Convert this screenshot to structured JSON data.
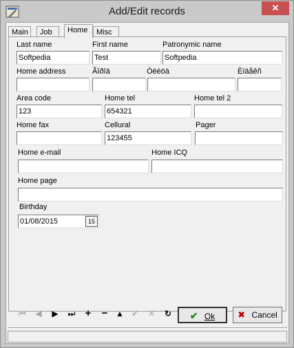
{
  "window": {
    "title": "Add/Edit records",
    "close_glyph": "✕"
  },
  "tabs": [
    {
      "label": "Main"
    },
    {
      "label": "Job"
    },
    {
      "label": "Home"
    },
    {
      "label": "Misc"
    }
  ],
  "home": {
    "last_name": {
      "label": "Last name",
      "value": "Softpedia"
    },
    "first_name": {
      "label": "First name",
      "value": "Test"
    },
    "patronymic_name": {
      "label": "Patronymic name",
      "value": "Softpedia"
    },
    "home_address": {
      "label": "Home address",
      "value": ""
    },
    "garbled_field_1": {
      "label": "Ãîðîä",
      "value": ""
    },
    "garbled_field_2": {
      "label": "Óëèöà",
      "value": ""
    },
    "garbled_field_3": {
      "label": "Èíäåêñ",
      "value": ""
    },
    "area_code": {
      "label": "Area code",
      "value": "123"
    },
    "home_tel": {
      "label": "Home tel",
      "value": "654321"
    },
    "home_tel_2": {
      "label": "Home tel 2",
      "value": ""
    },
    "home_fax": {
      "label": "Home fax",
      "value": ""
    },
    "cellural": {
      "label": "Cellural",
      "value": "123455"
    },
    "pager": {
      "label": "Pager",
      "value": ""
    },
    "home_email": {
      "label": "Home e-mail",
      "value": ""
    },
    "home_icq": {
      "label": "Home ICQ",
      "value": ""
    },
    "home_page": {
      "label": "Home page",
      "value": ""
    },
    "birthday": {
      "label": "Birthday",
      "value": "01/08/2015",
      "calendar_glyph": "15"
    }
  },
  "navigator": {
    "first": "⏮",
    "prior": "◀",
    "next": "▶",
    "last": "⏭",
    "insert": "+",
    "delete": "−",
    "edit": "▲",
    "post": "✔",
    "cancel": "✕",
    "refresh": "↻"
  },
  "buttons": {
    "ok": "Ok",
    "cancel": "Cancel",
    "ok_glyph": "✔",
    "cancel_glyph": "✖"
  },
  "colors": {
    "ok_check": "#1a8a1a",
    "cancel_x": "#c00000",
    "close_bg": "#c75050"
  }
}
